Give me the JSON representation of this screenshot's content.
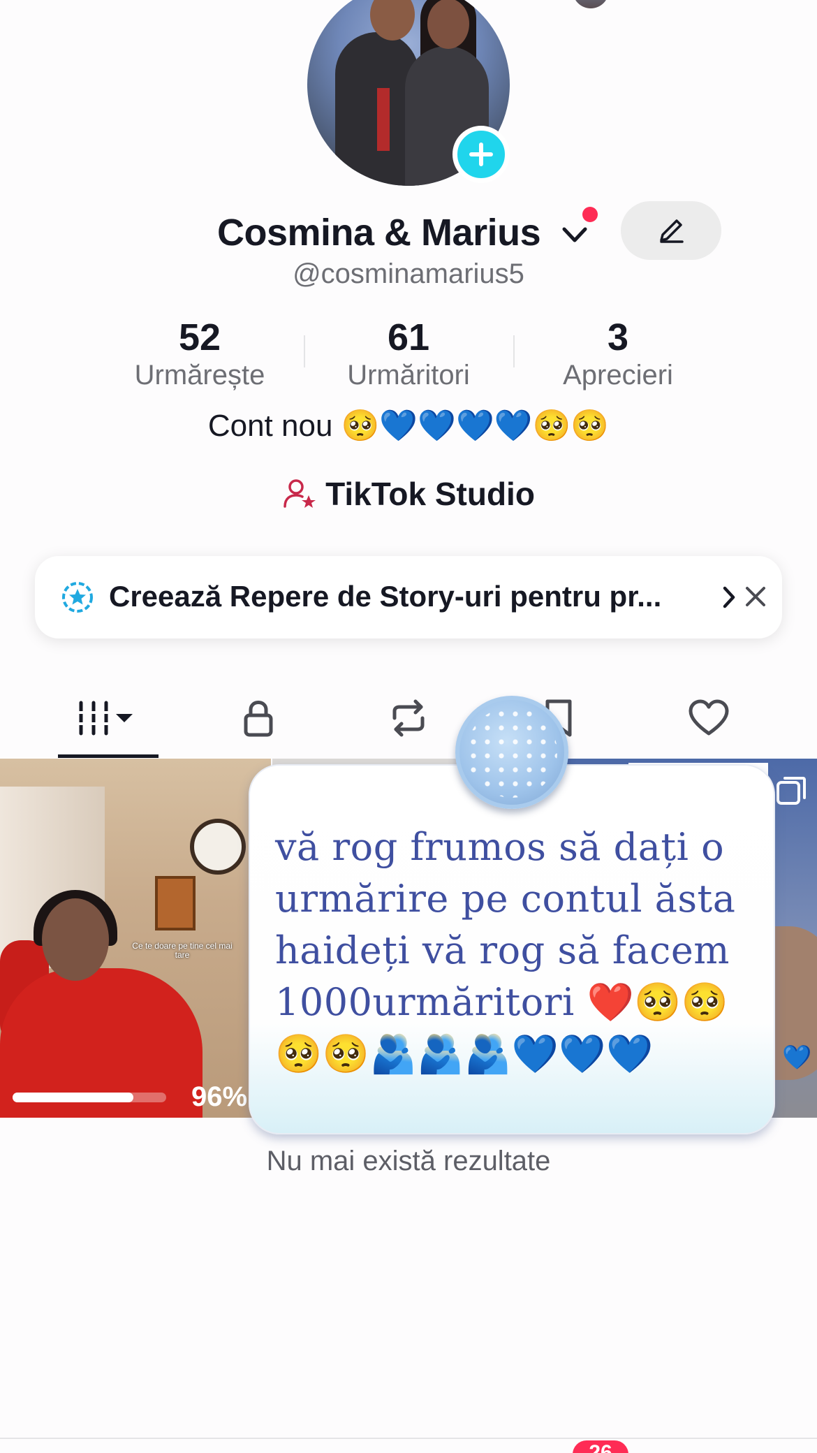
{
  "profile": {
    "display_name": "Cosmina & Marius",
    "username": "@cosminamarius5",
    "bio": "Cont nou 🥺💙💙💙💙🥺🥺"
  },
  "stats": [
    {
      "value": "52",
      "label": "Urmărește"
    },
    {
      "value": "61",
      "label": "Urmăritori"
    },
    {
      "value": "3",
      "label": "Aprecieri"
    }
  ],
  "studio": {
    "label": "TikTok Studio"
  },
  "banner": {
    "text": "Creează Repere de Story-uri pentru pr..."
  },
  "tabs": [
    {
      "name": "videos",
      "icon": "grid-icon",
      "active": true
    },
    {
      "name": "private",
      "icon": "lock-icon"
    },
    {
      "name": "reposts",
      "icon": "repost-icon"
    },
    {
      "name": "favorites",
      "icon": "bookmark-icon"
    },
    {
      "name": "liked",
      "icon": "heart-icon"
    }
  ],
  "videos": [
    {
      "caption": "Ce te doare pe tine cel mai tare",
      "upload_progress": 0.96,
      "upload_progress_label": "96%"
    }
  ],
  "sticker": {
    "text": " vă rog frumos să dați o urmărire pe contul ăsta haideți vă rog să facem 1000urmăritori ❤️🥺🥺🥺🥺🫂🫂🫂💙💙💙"
  },
  "footer": {
    "no_more_results": "Nu mai există rezultate",
    "inbox_badge": "26"
  },
  "colors": {
    "accent": "#fe2c55",
    "avatar_add": "#20d5ec",
    "sticker_text": "#3f4fa0"
  }
}
